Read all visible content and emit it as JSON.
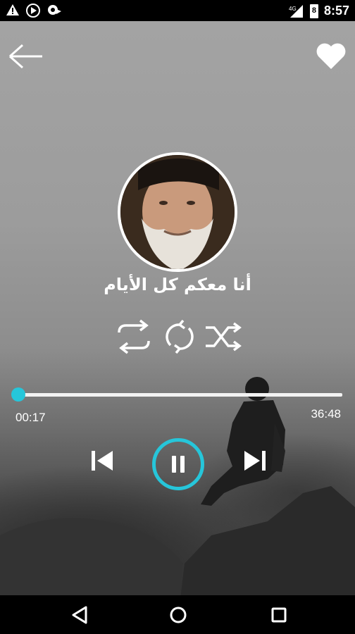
{
  "status_bar": {
    "time": "8:57",
    "battery_level": "8",
    "network": "4G",
    "icons": [
      "warning-icon",
      "play-circle-icon",
      "podcast-icon",
      "signal-icon",
      "battery-icon"
    ]
  },
  "header": {
    "back_icon": "arrow-left-icon",
    "favorite_icon": "heart-icon"
  },
  "track": {
    "title": "أنا معكم كل الأيام",
    "elapsed": "00:17",
    "duration": "36:48",
    "progress_fraction": 0.0077
  },
  "controls": {
    "mode_icons": [
      "repeat-icon",
      "repeat-one-icon",
      "shuffle-icon"
    ],
    "transport_icons": [
      "previous-icon",
      "pause-icon",
      "next-icon"
    ],
    "state": "playing"
  },
  "nav_bar": {
    "icons": [
      "back-triangle-icon",
      "home-circle-icon",
      "recents-square-icon"
    ]
  },
  "colors": {
    "accent": "#26c6da",
    "bars": "#000000",
    "text": "#ffffff"
  }
}
